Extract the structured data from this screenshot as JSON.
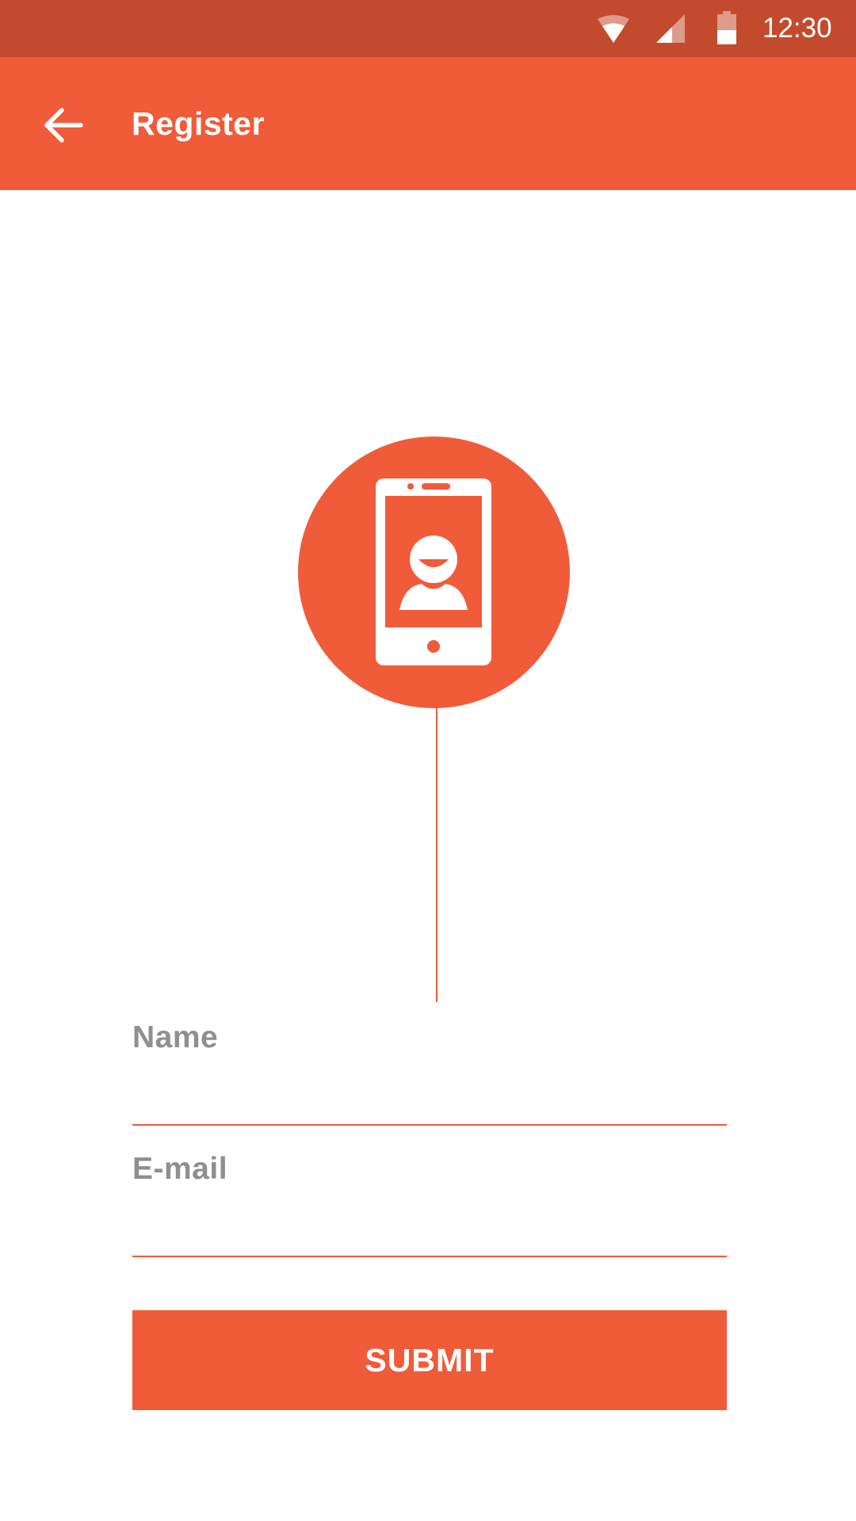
{
  "status_bar": {
    "time": "12:30",
    "icons": [
      "wifi-icon",
      "cell-signal-icon",
      "battery-icon"
    ],
    "background_color": "#c34a2d"
  },
  "app_bar": {
    "title": "Register",
    "back_icon": "arrow-back-icon",
    "background_color": "#f05b3a"
  },
  "illustration": {
    "icon": "phone-user-icon",
    "accent_color": "#f05b3a"
  },
  "form": {
    "name_label": "Name",
    "name_value": "",
    "email_label": "E-mail",
    "email_value": "",
    "underline_color": "#f05b3a",
    "submit_label": "SUBMIT"
  }
}
